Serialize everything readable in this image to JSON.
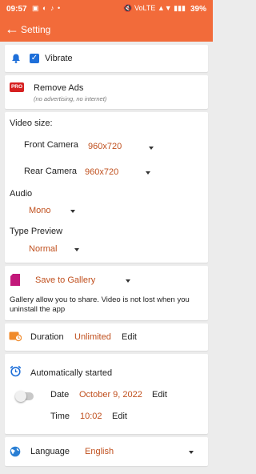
{
  "status_bar": {
    "time": "09:57",
    "notif_icons": "▣ ◐ ♪ •",
    "system_icons": "🔇 VoLTE ▲▼ ▮▮▮",
    "battery": "39%"
  },
  "app_bar": {
    "back_icon": "arrow-left-icon",
    "title": "Setting"
  },
  "vibrate": {
    "label": "Vibrate",
    "checked": true
  },
  "remove_ads": {
    "badge": "PRO",
    "title": "Remove Ads",
    "subtitle": "(no advertising, no internet)"
  },
  "video": {
    "header": "Video size:",
    "front_label": "Front Camera",
    "front_value": "960x720",
    "rear_label": "Rear Camera",
    "rear_value": "960x720",
    "audio_label": "Audio",
    "audio_value": "Mono",
    "preview_label": "Type Preview",
    "preview_value": "Normal"
  },
  "gallery": {
    "value": "Save to Gallery",
    "description": "Gallery allow you to share. Video is not lost when you uninstall the app"
  },
  "duration": {
    "label": "Duration",
    "value": "Unlimited",
    "edit": "Edit"
  },
  "auto_start": {
    "label": "Automatically started",
    "enabled": false,
    "date_label": "Date",
    "date_value": "October 9, 2022",
    "date_edit": "Edit",
    "time_label": "Time",
    "time_value": "10:02",
    "time_edit": "Edit"
  },
  "language": {
    "label": "Language",
    "value": "English"
  },
  "colors": {
    "accent": "#f26b3a",
    "value_text": "#c0501e",
    "checkbox": "#1e6fd9",
    "pro_badge": "#d62020"
  }
}
